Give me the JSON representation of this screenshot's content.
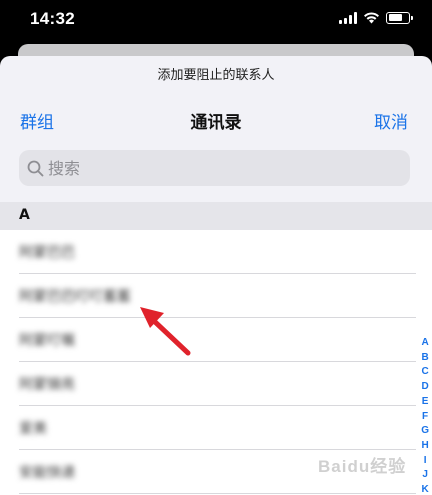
{
  "status_bar": {
    "time": "14:32"
  },
  "sheet": {
    "prompt": "添加要阻止的联系人",
    "left_label": "群组",
    "title": "通讯录",
    "right_label": "取消",
    "search_placeholder": "搜索"
  },
  "section": {
    "letter": "A"
  },
  "contacts": [
    {
      "name": "阿蒙巴巴"
    },
    {
      "name": "阿蒙巴巴叮叮蓄蓄"
    },
    {
      "name": "阿蒙叮嘱"
    },
    {
      "name": "阿蒙锦亮"
    },
    {
      "name": "爱美"
    },
    {
      "name": "安能快递"
    }
  ],
  "index_letters": [
    "A",
    "B",
    "C",
    "D",
    "E",
    "F",
    "G",
    "H",
    "I",
    "J",
    "K"
  ],
  "watermark": "Baidu经验",
  "colors": {
    "accent": "#1a73e8",
    "arrow": "#e0222b"
  }
}
